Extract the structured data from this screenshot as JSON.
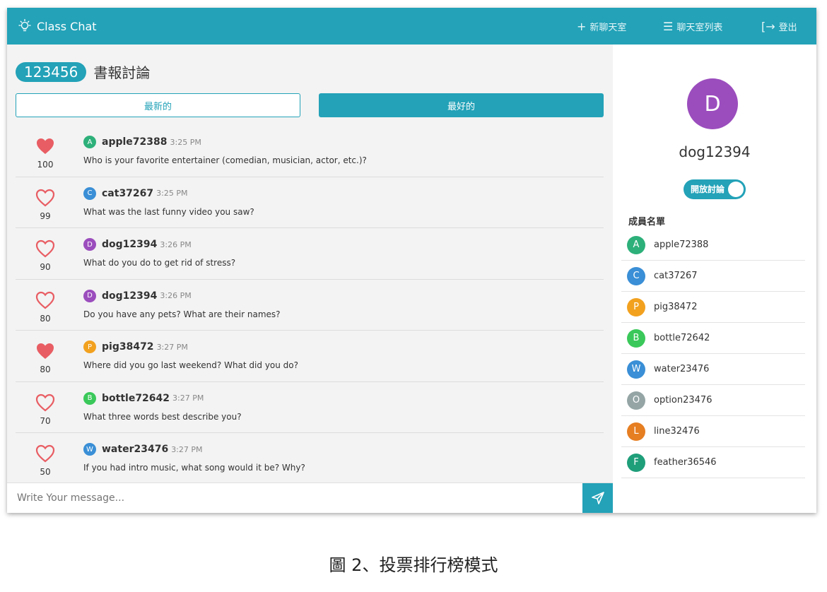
{
  "navbar": {
    "brand": "Class Chat",
    "new_room": "新聊天室",
    "room_list": "聊天室列表",
    "logout": "登出",
    "new_room_glyph": "+",
    "room_list_glyph": "☰",
    "logout_glyph": "[→"
  },
  "room": {
    "id": "123456",
    "name": "書報討論"
  },
  "tabs": {
    "latest": "最新的",
    "best": "最好的"
  },
  "messages": [
    {
      "initial": "A",
      "user": "apple72388",
      "time": "3:25 PM",
      "text": "Who is your favorite entertainer (comedian, musician, actor, etc.)?",
      "votes": "100",
      "liked": true,
      "color": "#2db07a"
    },
    {
      "initial": "C",
      "user": "cat37267",
      "time": "3:25 PM",
      "text": "What was the last funny video you saw?",
      "votes": "99",
      "liked": false,
      "color": "#3a8fd6"
    },
    {
      "initial": "D",
      "user": "dog12394",
      "time": "3:26 PM",
      "text": "What do you do to get rid of stress?",
      "votes": "90",
      "liked": false,
      "color": "#9b4dbd"
    },
    {
      "initial": "D",
      "user": "dog12394",
      "time": "3:26 PM",
      "text": "Do you have any pets? What are their names?",
      "votes": "80",
      "liked": false,
      "color": "#9b4dbd"
    },
    {
      "initial": "P",
      "user": "pig38472",
      "time": "3:27 PM",
      "text": "Where did you go last weekend? What did you do?",
      "votes": "80",
      "liked": true,
      "color": "#f2a11f"
    },
    {
      "initial": "B",
      "user": "bottle72642",
      "time": "3:27 PM",
      "text": "What three words best describe you?",
      "votes": "70",
      "liked": false,
      "color": "#3ac85a"
    },
    {
      "initial": "W",
      "user": "water23476",
      "time": "3:27 PM",
      "text": "If you had intro music, what song would it be? Why?",
      "votes": "50",
      "liked": false,
      "color": "#3a8fd6"
    }
  ],
  "composer": {
    "placeholder": "Write Your message..."
  },
  "sidebar": {
    "current_user_initial": "D",
    "current_user": "dog12394",
    "toggle_label": "開放討論",
    "members_title": "成員名單",
    "members": [
      {
        "initial": "A",
        "name": "apple72388",
        "color": "#2db07a"
      },
      {
        "initial": "C",
        "name": "cat37267",
        "color": "#3a8fd6"
      },
      {
        "initial": "P",
        "name": "pig38472",
        "color": "#f2a11f"
      },
      {
        "initial": "B",
        "name": "bottle72642",
        "color": "#3ac85a"
      },
      {
        "initial": "W",
        "name": "water23476",
        "color": "#3a8fd6"
      },
      {
        "initial": "O",
        "name": "option23476",
        "color": "#95a5a6"
      },
      {
        "initial": "L",
        "name": "line32476",
        "color": "#e67e22"
      },
      {
        "initial": "F",
        "name": "feather36546",
        "color": "#1f9e7a"
      }
    ]
  },
  "colors": {
    "accent": "#23a2b8",
    "heart": "#e85d63"
  },
  "caption": "圖 2、投票排行榜模式"
}
